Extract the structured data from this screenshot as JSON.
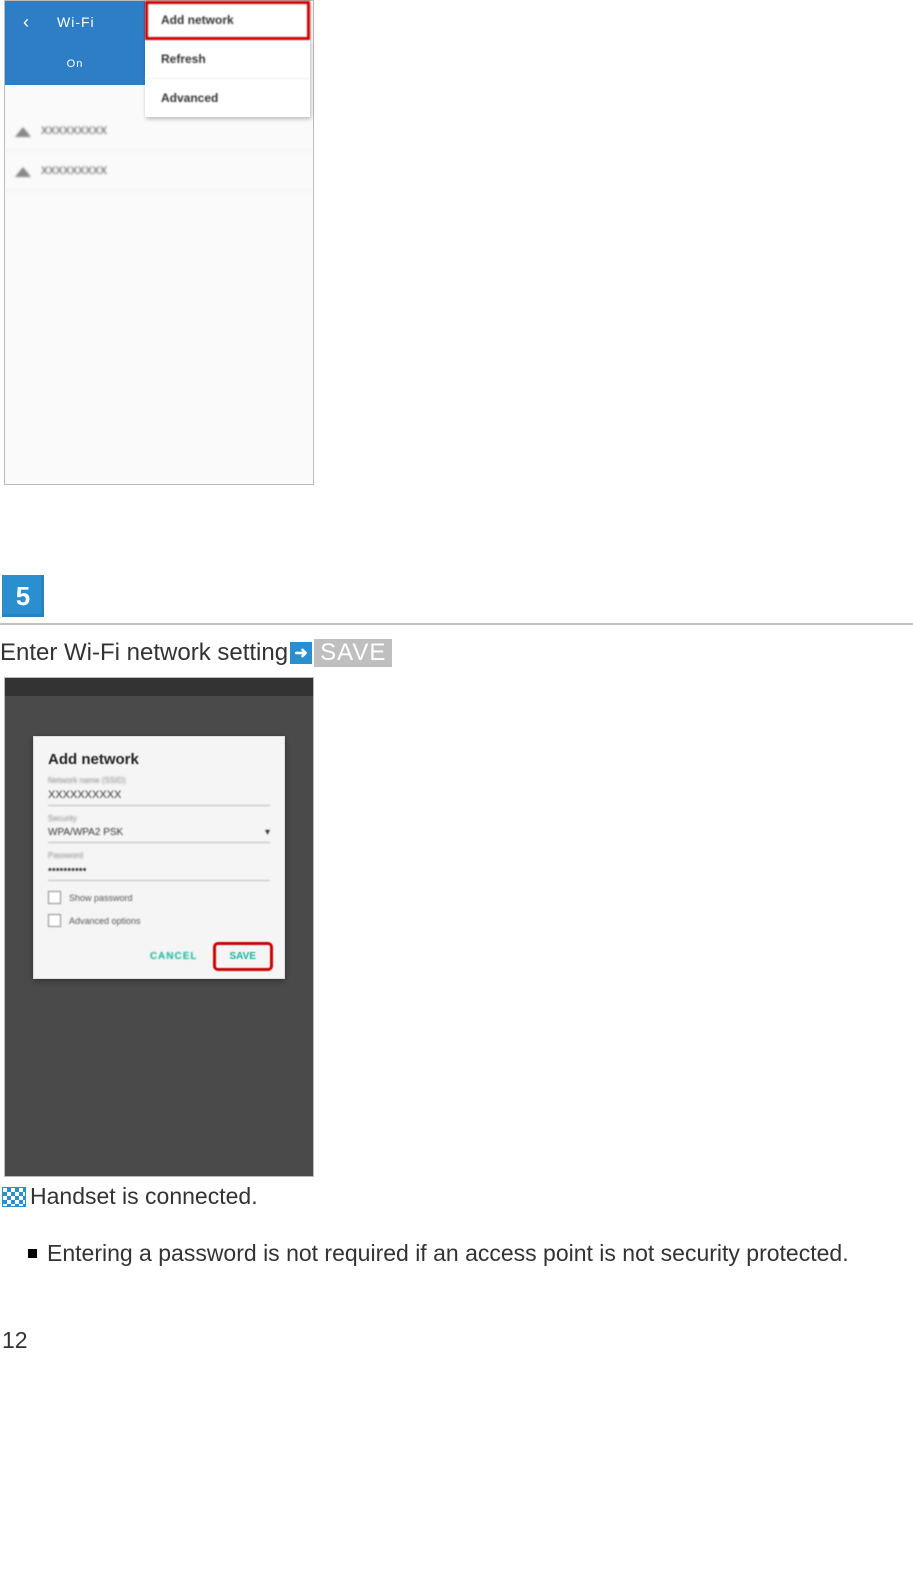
{
  "screenshot1": {
    "header_title": "Wi-Fi",
    "toggle": "On",
    "menu": [
      {
        "label": "Add network",
        "highlighted": true
      },
      {
        "label": "Refresh"
      },
      {
        "label": "Advanced"
      }
    ],
    "networks": [
      {
        "ssid": "XXXXXXXXX"
      },
      {
        "ssid": "XXXXXXXXX"
      }
    ]
  },
  "step": {
    "number": "5",
    "instruction_text": "Enter Wi-Fi network setting",
    "save_label": "SAVE"
  },
  "screenshot2": {
    "dialog_title": "Add network",
    "field_ssid_label": "Network name (SSID)",
    "field_ssid_value": "XXXXXXXXXX",
    "field_security_label": "Security",
    "field_security_value": "WPA/WPA2 PSK",
    "field_password_label": "Password",
    "field_password_value": "••••••••••",
    "check_show_password": "Show password",
    "check_advanced": "Advanced options",
    "btn_cancel": "CANCEL",
    "btn_save": "SAVE"
  },
  "result_text": "Handset is connected.",
  "note_text": "Entering a password is not required if an access point is not security protected.",
  "page_number": "12"
}
